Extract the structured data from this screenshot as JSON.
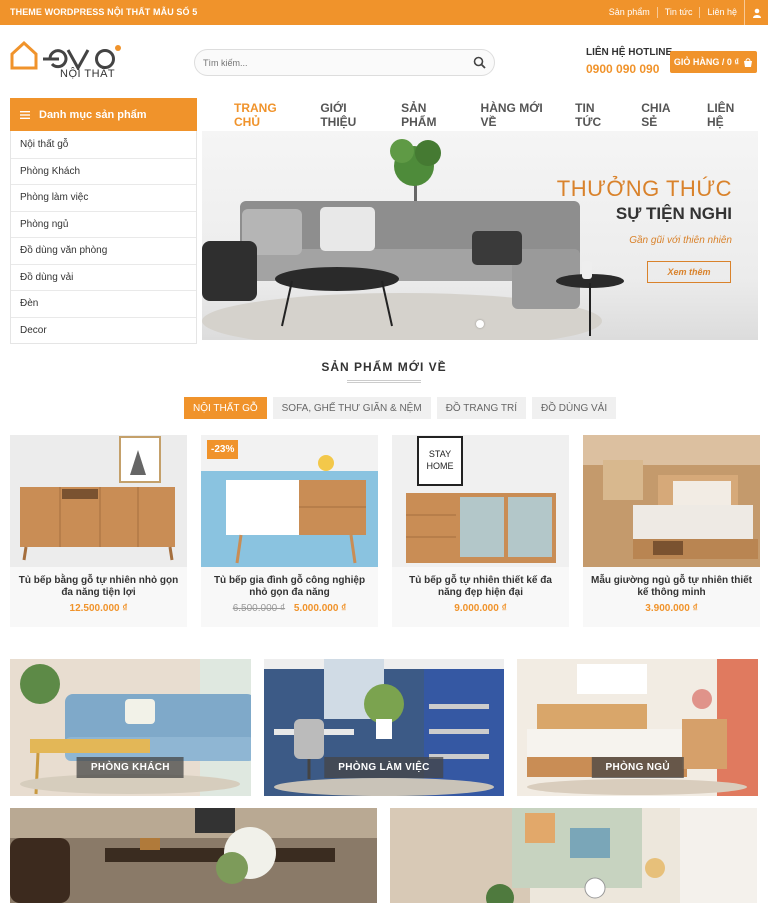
{
  "topbar": {
    "brand": "THEME WORDPRESS NỘI THẤT MẪU SỐ 5",
    "links": [
      "Sản phẩm",
      "Tin tức",
      "Liên hệ"
    ]
  },
  "header": {
    "logo_subtitle": "NỘI THẤT",
    "search_placeholder": "Tìm kiếm...",
    "hotline_label": "LIÊN HỆ HOTLINE",
    "hotline_number": "0900 090 090",
    "cart_label": "GIỎ HÀNG / 0 ₫"
  },
  "categories": {
    "title": "Danh mục sản phẩm",
    "items": [
      "Nội thất gỗ",
      "Phòng Khách",
      "Phòng làm việc",
      "Phòng ngủ",
      "Đồ dùng văn phòng",
      "Đồ dùng vải",
      "Đèn",
      "Decor"
    ]
  },
  "nav": [
    "TRANG CHỦ",
    "GIỚI THIỆU",
    "SẢN PHẨM",
    "HÀNG MỚI VỀ",
    "TIN TỨC",
    "CHIA SẺ",
    "LIÊN HỆ"
  ],
  "slider": {
    "line1": "THƯỞNG THỨC",
    "line2": "SỰ TIỆN NGHI",
    "line3": "Gần gũi với thiên nhiên",
    "button": "Xem thêm"
  },
  "section": {
    "title": "SẢN PHẨM MỚI VỀ",
    "tabs": [
      "NỘI THẤT GỖ",
      "SOFA, GHẾ THƯ GIÃN & NỆM",
      "ĐỒ TRANG TRÍ",
      "ĐỒ DÙNG VẢI"
    ]
  },
  "products": [
    {
      "name": "Tủ bếp bằng gỗ tự nhiên nhỏ gọn đa năng tiện lợi",
      "price": "12.500.000 ₫",
      "old_price": "",
      "badge": ""
    },
    {
      "name": "Tủ bếp gia đình gỗ công nghiệp nhỏ gọn đa năng",
      "price": "5.000.000 ₫",
      "old_price": "6.500.000 ₫",
      "badge": "-23%"
    },
    {
      "name": "Tủ bếp gỗ tự nhiên thiết kế đa năng đẹp hiện đại",
      "price": "9.000.000 ₫",
      "old_price": "",
      "badge": ""
    },
    {
      "name": "Mẫu giường ngủ gỗ tự nhiên thiết kế thông minh",
      "price": "3.900.000 ₫",
      "old_price": "",
      "badge": ""
    }
  ],
  "rooms": [
    "PHÒNG KHÁCH",
    "PHÒNG LÀM VIỆC",
    "PHÒNG NGỦ"
  ],
  "colors": {
    "accent": "#f0932b"
  }
}
